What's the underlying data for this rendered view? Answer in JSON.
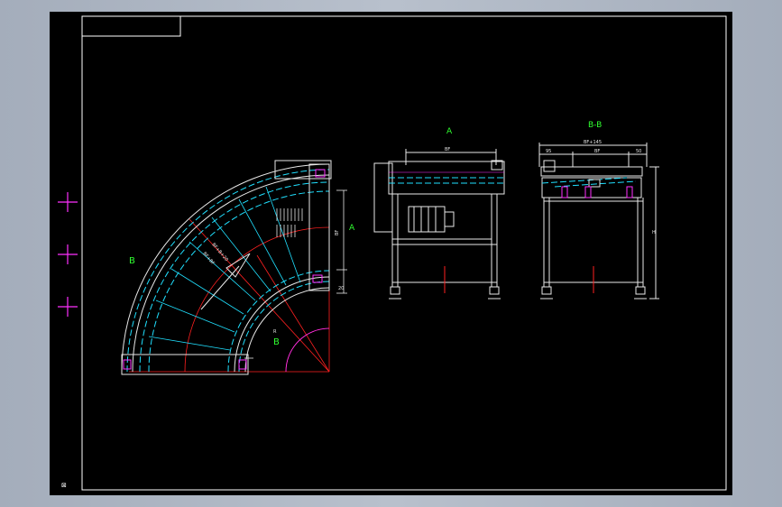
{
  "colors": {
    "background": "#000000",
    "frame": "#ffffff",
    "red": "#ff2020",
    "cyan": "#20e0ff",
    "white": "#e8e8e8",
    "magenta": "#ff30ff",
    "green": "#30ff30"
  },
  "plan_view": {
    "section_mark_left": "B",
    "section_mark_right": "B",
    "view_arrow": "A",
    "dim_vertical": "BF",
    "dim_small": "20",
    "dim_radius_inner": "R",
    "dim_arc_1": "BF+BF",
    "dim_arc_2": "BF+B+20"
  },
  "view_a": {
    "title": "A",
    "dim_top": "BF"
  },
  "view_bb": {
    "title": "B-B",
    "dim_total": "BF+145",
    "dim_left": "95",
    "dim_mid": "BF",
    "dim_right": "50",
    "dim_height": "H"
  },
  "corner_mark": "⊠"
}
